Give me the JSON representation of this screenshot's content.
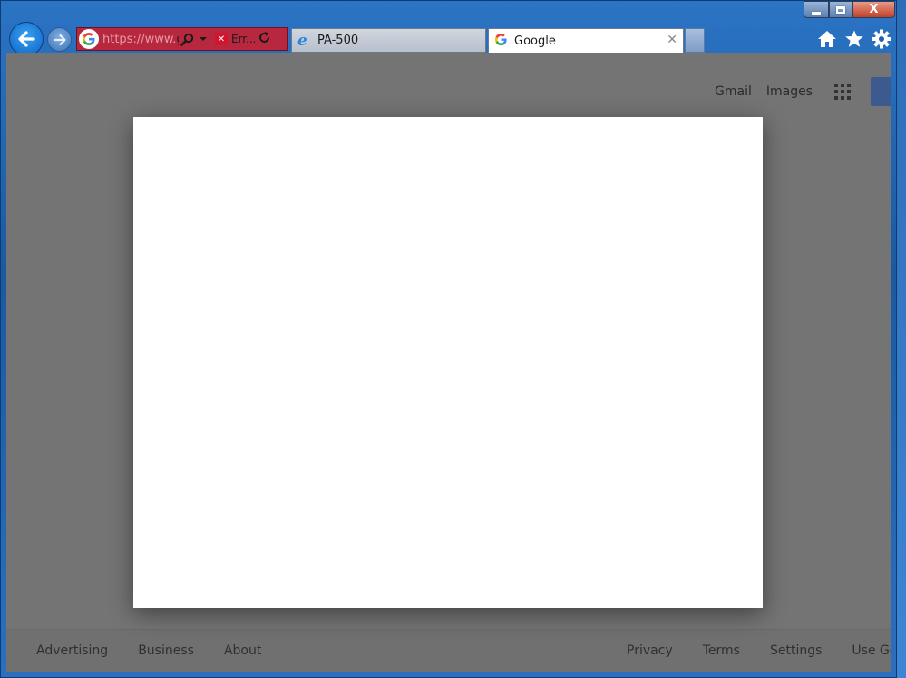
{
  "window": {
    "caption_buttons": {
      "minimize": "minimize",
      "maximize": "maximize",
      "close": "X"
    }
  },
  "nav": {
    "back_icon": "back-arrow-icon",
    "forward_icon": "forward-arrow-icon"
  },
  "addressbar": {
    "url_faded": "https://www.",
    "url_dark": "g",
    "error_label": "Err..."
  },
  "tabs": [
    {
      "label": "PA-500",
      "icon": "ie-icon",
      "active": false
    },
    {
      "label": "Google",
      "icon": "google-icon",
      "active": true
    }
  ],
  "toolbar": {
    "icons": [
      "home-icon",
      "favorites-star-icon",
      "settings-gear-icon"
    ]
  },
  "page": {
    "topnav": {
      "gmail": "Gmail",
      "images": "Images"
    },
    "footer": {
      "left": [
        "Advertising",
        "Business",
        "About"
      ],
      "right": [
        "Privacy",
        "Terms",
        "Settings",
        "Use Goo"
      ]
    }
  },
  "colors": {
    "address_error_bg": "#b7283f",
    "overlay": "#747474",
    "frame": "#1f5fa6"
  }
}
